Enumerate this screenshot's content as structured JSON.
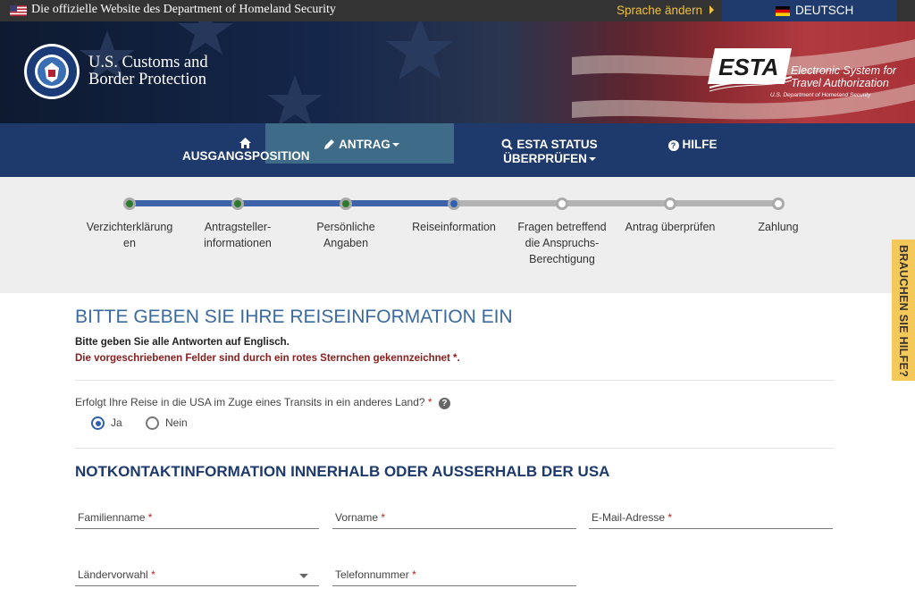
{
  "gov_bar": {
    "official_text": "Die offizielle Website des Department of Homeland Security",
    "change_language": "Sprache ändern",
    "language": "DEUTSCH"
  },
  "header": {
    "agency_line1": "U.S. Customs and",
    "agency_line2": "Border Protection",
    "esta_logo_text": "ESTA",
    "esta_tagline_1": "Electronic System for",
    "esta_tagline_2": "Travel Authorization",
    "esta_dept": "U.S. Department of Homeland Security"
  },
  "nav": {
    "items": [
      {
        "label": "AUSGANGSPOSITION",
        "icon": "home-icon",
        "dropdown": false
      },
      {
        "label": "ANTRAG",
        "icon": "pencil-icon",
        "dropdown": true,
        "active": true
      },
      {
        "label_line1": "ESTA STATUS",
        "label_line2": "ÜBERPRÜFEN",
        "icon": "search-icon",
        "dropdown": true
      },
      {
        "label": "HILFE",
        "icon": "question-icon",
        "dropdown": false
      }
    ]
  },
  "progress": {
    "current_step": 4,
    "steps": [
      {
        "label": "Verzichterklärung en",
        "state": "done"
      },
      {
        "label": "Antragsteller-informationen",
        "state": "done"
      },
      {
        "label": "Persönliche Angaben",
        "state": "done"
      },
      {
        "label": "Reiseinformation",
        "state": "current"
      },
      {
        "label": "Fragen betreffend die Anspruchs-Berechtigung",
        "state": "todo"
      },
      {
        "label": "Antrag überprüfen",
        "state": "todo"
      },
      {
        "label": "Zahlung",
        "state": "todo"
      }
    ]
  },
  "help_tab": "BRAUCHEN SIE HILFE?",
  "form": {
    "title": "BITTE GEBEN SIE IHRE REISEINFORMATION EIN",
    "instruction": "Bitte geben Sie alle Antworten auf Englisch.",
    "required_note": "Die vorgeschriebenen Felder sind durch ein rotes Sternchen gekennzeichnet *.",
    "transit_question": "Erfolgt Ihre Reise in die USA im Zuge eines Transits in ein anderes Land?",
    "required_mark": "*",
    "transit_options": [
      "Ja",
      "Nein"
    ],
    "transit_selected": "Ja",
    "emergency_title": "NOTKONTAKTINFORMATION INNERHALB ODER AUSSERHALB DER USA",
    "fields": {
      "family_name": "Familienname",
      "first_name": "Vorname",
      "email": "E-Mail-Adresse",
      "country_code": "Ländervorwahl",
      "phone": "Telefonnummer"
    }
  },
  "colors": {
    "nav_bg": "#1e3a6c",
    "nav_active": "#3d6b88",
    "progress_done": "#3f63a8",
    "dot_done": "#2e7a2e",
    "required": "#b22222",
    "help_tab": "#f5c85a"
  }
}
